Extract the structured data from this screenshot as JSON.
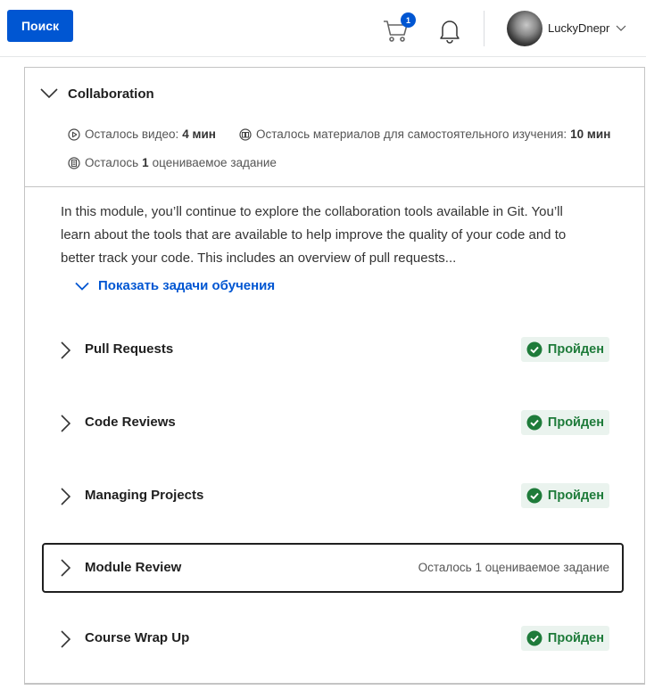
{
  "header": {
    "search_label": "Поиск",
    "cart_count": "1",
    "username": "LuckyDnepr"
  },
  "module": {
    "title": "Collaboration",
    "video_label": "Осталось видео:",
    "video_value": "4 мин",
    "reading_label": "Осталось материалов для самостоятельного изучения:",
    "reading_value": "10 мин",
    "graded_prefix": "Осталось",
    "graded_count": "1",
    "graded_suffix": "оцениваемое задание",
    "description": "In this module, you’ll continue to explore the collaboration tools available in Git. You’ll learn about the tools that are available to help improve the quality of your code and to better track your code. This includes an overview of pull requests...",
    "show_goals": "Показать задачи обучения"
  },
  "lessons": [
    {
      "title": "Pull Requests",
      "status": "Пройден"
    },
    {
      "title": "Code Reviews",
      "status": "Пройден"
    },
    {
      "title": "Managing Projects",
      "status": "Пройден"
    },
    {
      "title": "Module Review",
      "remaining": "Осталось 1 оцениваемое задание"
    },
    {
      "title": "Course Wrap Up",
      "status": "Пройден"
    }
  ],
  "colors": {
    "accent": "#0056d2",
    "success_text": "#1e7b3a",
    "success_bg": "#eaf3ee"
  }
}
